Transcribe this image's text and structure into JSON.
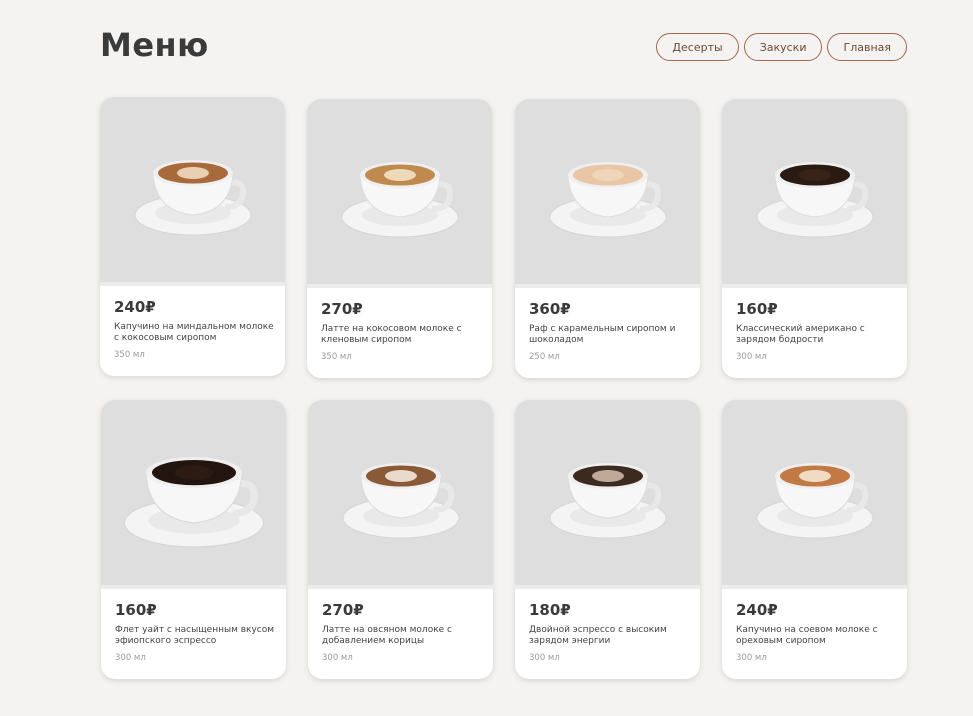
{
  "header": {
    "title": "Меню",
    "nav": [
      {
        "label": "Десерты"
      },
      {
        "label": "Закуски"
      },
      {
        "label": "Главная"
      }
    ]
  },
  "colors": {
    "accent": "#a0694a",
    "background": "#f4f3f1",
    "card": "#ffffff",
    "photo_bg": "#dedede"
  },
  "products": [
    {
      "price": "240₽",
      "description": "Капучино на миндальном молоке с кокосовым сиропом",
      "volume": "350 мл",
      "drink": "cappuccino-latte-art"
    },
    {
      "price": "270₽",
      "description": "Латте на кокосовом молоке с кленовым сиропом",
      "volume": "350 мл",
      "drink": "latte-latte-art"
    },
    {
      "price": "360₽",
      "description": "Раф с карамельным сиропом и шоколадом",
      "volume": "250 мл",
      "drink": "raf"
    },
    {
      "price": "160₽",
      "description": "Классический американо с зарядом бодрости",
      "volume": "300 мл",
      "drink": "americano"
    },
    {
      "price": "160₽",
      "description": "Флет уайт с насыщенным вкусом эфиопского эспрессо",
      "volume": "300 мл",
      "drink": "flat-white"
    },
    {
      "price": "270₽",
      "description": "Латте на овсяном молоке с добавлением корицы",
      "volume": "300 мл",
      "drink": "latte-heart"
    },
    {
      "price": "180₽",
      "description": "Двойной эспрессо с высоким зарядом энергии",
      "volume": "300 мл",
      "drink": "espresso"
    },
    {
      "price": "240₽",
      "description": "Капучино на соевом молоке с ореховым сиропом",
      "volume": "300 мл",
      "drink": "cappuccino-tulip"
    }
  ]
}
